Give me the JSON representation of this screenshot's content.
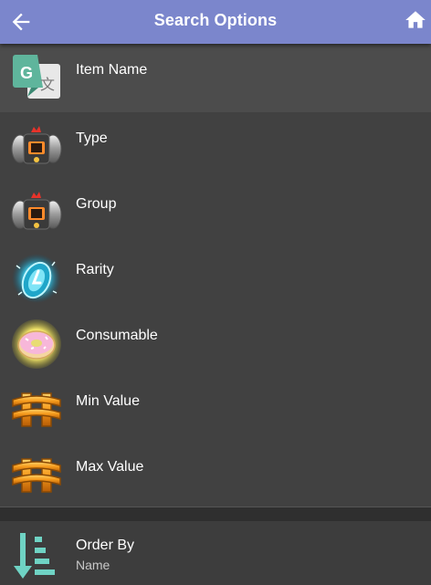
{
  "header": {
    "title": "Search Options",
    "back_icon": "arrow-left-icon",
    "home_icon": "home-icon",
    "background_color": "#7b86cc"
  },
  "options": [
    {
      "label": "Item Name",
      "icon": "translate-icon"
    },
    {
      "label": "Type",
      "icon": "capsule-robot-icon"
    },
    {
      "label": "Group",
      "icon": "capsule-robot-icon"
    },
    {
      "label": "Rarity",
      "icon": "crystal-icon"
    },
    {
      "label": "Consumable",
      "icon": "donut-icon"
    },
    {
      "label": "Min Value",
      "icon": "currency-icon"
    },
    {
      "label": "Max Value",
      "icon": "currency-icon"
    }
  ],
  "order_by": {
    "title": "Order By",
    "value": "Name",
    "icon": "sort-descending-icon"
  }
}
